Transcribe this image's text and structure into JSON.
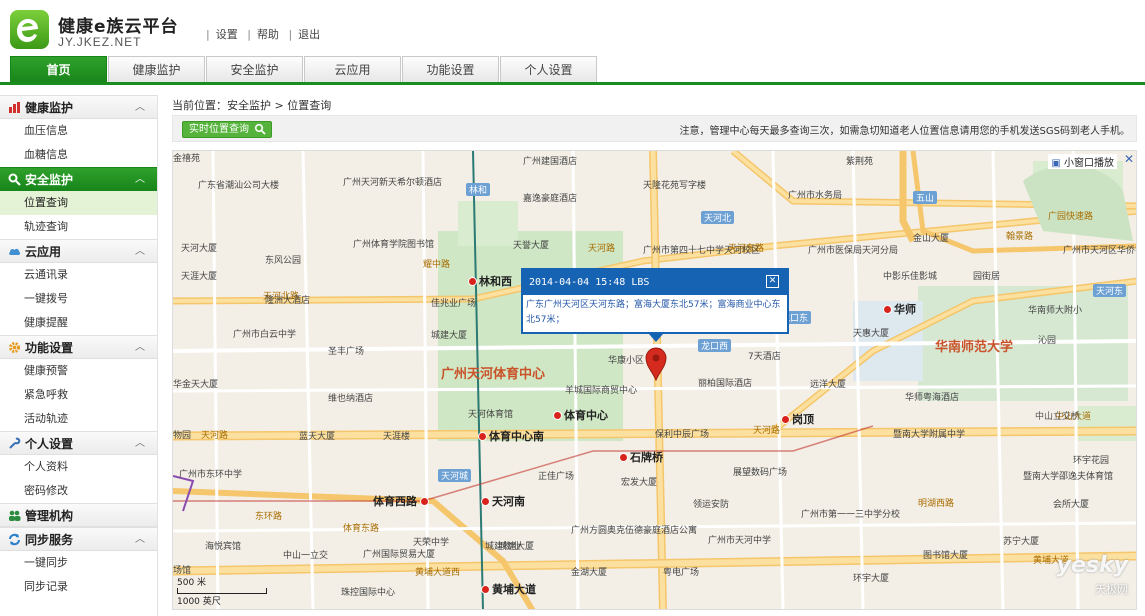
{
  "header": {
    "title": "健康e族云平台",
    "domain": "JY.JKEZ.NET",
    "links": [
      "设置",
      "帮助",
      "退出"
    ]
  },
  "nav": {
    "tabs": [
      "首页",
      "健康监护",
      "安全监护",
      "云应用",
      "功能设置",
      "个人设置"
    ],
    "active_index": 0
  },
  "sidebar": {
    "groups": [
      {
        "label": "健康监护",
        "icon": "chart-icon",
        "items": [
          "血压信息",
          "血糖信息"
        ]
      },
      {
        "label": "安全监护",
        "icon": "search-icon",
        "items": [
          "位置查询",
          "轨迹查询"
        ],
        "active": true
      },
      {
        "label": "云应用",
        "icon": "cloud-icon",
        "items": [
          "云通讯录",
          "一键拨号",
          "健康提醒"
        ]
      },
      {
        "label": "功能设置",
        "icon": "gear-icon",
        "items": [
          "健康预警",
          "紧急呼救",
          "活动轨迹"
        ]
      },
      {
        "label": "个人设置",
        "icon": "wrench-icon",
        "items": [
          "个人资料",
          "密码修改"
        ]
      },
      {
        "label": "管理机构",
        "icon": "people-icon",
        "items": []
      },
      {
        "label": "同步服务",
        "icon": "sync-icon",
        "items": [
          "一键同步",
          "同步记录"
        ]
      }
    ],
    "active_item": "位置查询"
  },
  "main": {
    "breadcrumb": "当前位置：安全监护 > 位置查询",
    "locate_button": "实时位置查询",
    "notice": "注意，管理中心每天最多查询三次，如需急切知道老人位置信息请用您的手机发送SGS码到老人手机。"
  },
  "map": {
    "mini_window": "小窗口播放",
    "close_glyph": "✕",
    "popup": {
      "header": "2014-04-04 15:48 LBS",
      "body": "广东广州天河区天河东路；富海大厦东北57米；富海商业中心东北57米；",
      "close_glyph": "✕"
    },
    "scale": {
      "metric": "500 米",
      "imperial": "1000 英尺"
    },
    "watermark": "yesky",
    "watermark_sub": "天极网",
    "labels": {
      "l1": "广州天河新天希尔顿酒店",
      "l2": "广州建国酒店",
      "l3": "嘉逸豪庭酒店",
      "l4": "天隆花苑写字楼",
      "l5": "广州市水务局",
      "l6": "紫荆苑",
      "l7": "天河北",
      "l8": "广州体育学院图书馆",
      "l9": "东风公园",
      "l10": "天誉大厦",
      "l11": "林和西",
      "l12": "广州天河体育中心",
      "l13": "体育中心",
      "l14": "体育中心南",
      "l15": "石牌桥",
      "l16": "岗顶",
      "l17": "华师",
      "l18": "华南师范大学",
      "l19": "体育西路",
      "l20": "天河南",
      "l21": "黄埔大道",
      "l22": "天河路",
      "l23": "天河北路",
      "l24": "中山大道",
      "l25": "广州国际贸易大厦",
      "l26": "正佳广场",
      "l27": "宏发大厦",
      "l28": "领运安防",
      "l29": "展望数码广场",
      "l30": "广州市第一一三中学分校",
      "l31": "暨南大学附属中学",
      "l32": "羊城国际商贸中心",
      "l33": "保利中辰广场",
      "l34": "丽柏国际酒店",
      "l35": "远洋大厦",
      "l36": "华师粤海酒店",
      "l37": "中山立交桥",
      "l38": "环宇花园",
      "l39": "图书馆大厦",
      "l40": "会所大厦",
      "l41": "天河城",
      "l42": "城建大厦",
      "l43": "金湖大厦",
      "l44": "中影乐佳影城",
      "l45": "园街居",
      "l46": "广州市医保局天河分局",
      "l47": "金山大厦",
      "l48": "广州市第四十七中学天河校区",
      "l49": "天河东",
      "l50": "龙口东",
      "l51": "龙口西",
      "l52": "7天酒店",
      "l53": "天惠大厦",
      "l54": "沁园",
      "l55": "天河大厦",
      "l56": "华南师大附小",
      "l57": "广州市天河区华侨学校",
      "l58": "天河东路",
      "l59": "广园快速路",
      "l60": "五山",
      "l61": "翰景路",
      "l62": "天河路",
      "l63": "天河路",
      "l64": "中山一立交",
      "l65": "黄埔大道西",
      "l66": "华康小区",
      "l67": "天河体育馆",
      "l68": "蓝天大厦",
      "l69": "天涯楼",
      "l70": "维也纳酒店",
      "l71": "城建大厦",
      "l72": "圣丰广场",
      "l73": "佳兆业广场",
      "l74": "隆洲大酒店",
      "l75": "耀中路",
      "l76": "天涯大厦",
      "l77": "广州市白云中学",
      "l78": "华金天大厦",
      "l79": "东环路",
      "l80": "广州市东环中学",
      "l81": "海悦宾馆",
      "l82": "天荣中学",
      "l83": "城建物业",
      "l84": "广州方圆奥克伍德豪庭酒店公寓",
      "l85": "广州市天河中学",
      "l86": "金湖大厦",
      "l87": "粤电广场",
      "l88": "环宇大厦",
      "l89": "中信大厦",
      "l90": "场馆",
      "l91": "体育东路",
      "l92": "暨南大学邵逸夫体育馆",
      "l93": "明湖西路",
      "l94": "苏宁大厦",
      "l95": "珠控国际中心",
      "l96": "金禧苑",
      "l97": "林和",
      "l98": "黄埔大道",
      "l99": "广东省潮汕公司大楼",
      "l100": "物园"
    }
  }
}
